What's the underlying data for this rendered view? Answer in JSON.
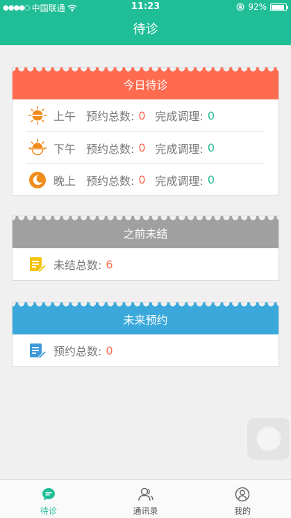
{
  "status": {
    "carrier": "中国联通",
    "time": "11:23",
    "battery": "92%",
    "battery_level": 0.92
  },
  "nav": {
    "title": "待诊"
  },
  "today": {
    "title": "今日待诊",
    "color": "#ff6b4f",
    "rows": [
      {
        "icon": "sun-icon",
        "period": "上午",
        "total_label": "预约总数:",
        "total": "0",
        "done_label": "完成调理:",
        "done": "0"
      },
      {
        "icon": "sunset-icon",
        "period": "下午",
        "total_label": "预约总数:",
        "total": "0",
        "done_label": "完成调理:",
        "done": "0"
      },
      {
        "icon": "moon-icon",
        "period": "晚上",
        "total_label": "预约总数:",
        "total": "0",
        "done_label": "完成调理:",
        "done": "0"
      }
    ]
  },
  "previous": {
    "title": "之前未结",
    "color": "#a0a0a0",
    "label": "未结总数:",
    "value": "6"
  },
  "future": {
    "title": "未来预约",
    "color": "#3aa8db",
    "label": "预约总数:",
    "value": "0"
  },
  "tabs": [
    {
      "label": "待诊",
      "icon": "chat-bubble-icon",
      "active": true
    },
    {
      "label": "通讯录",
      "icon": "contacts-icon",
      "active": false
    },
    {
      "label": "我的",
      "icon": "profile-icon",
      "active": false
    }
  ]
}
